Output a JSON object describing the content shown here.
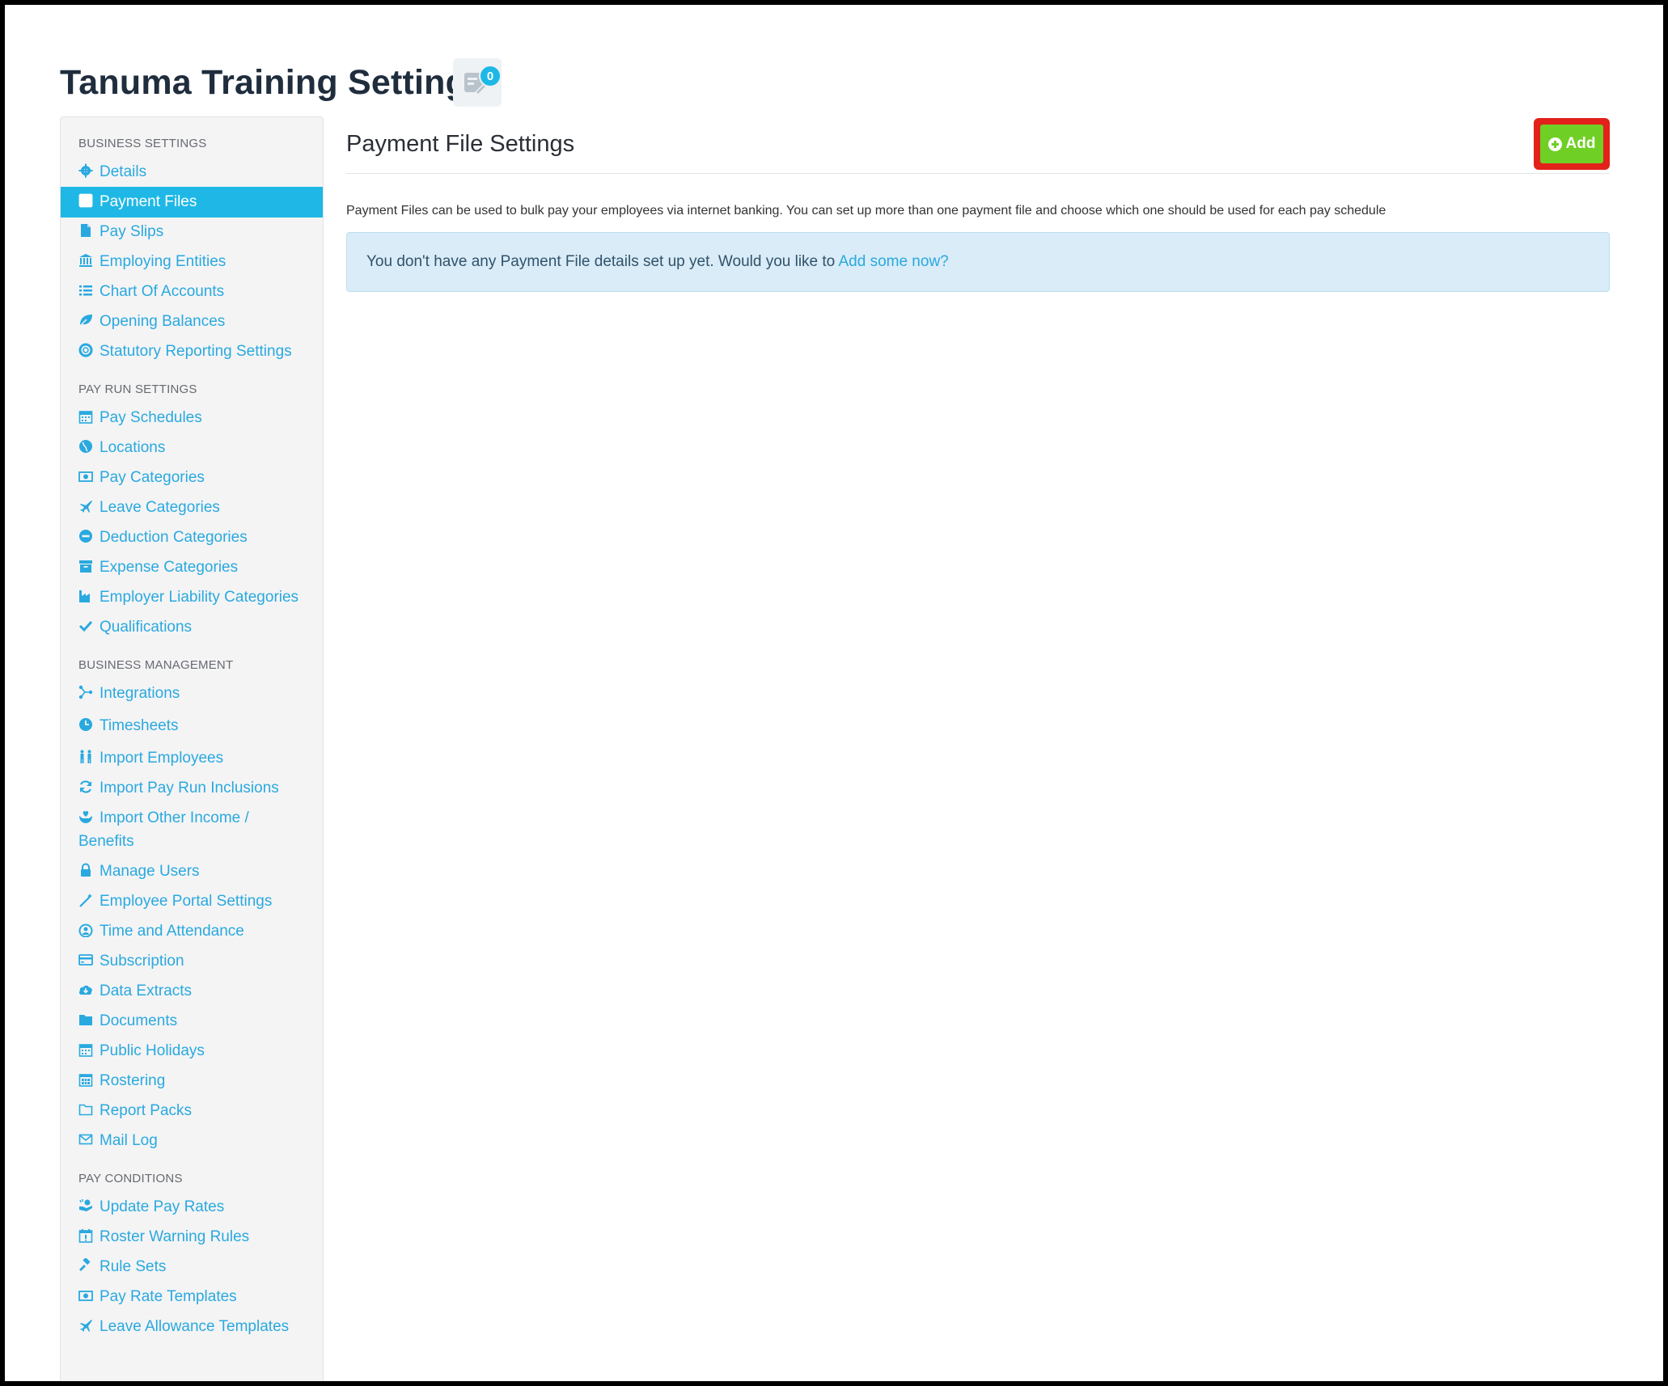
{
  "page": {
    "title": "Tanuma Training Settings",
    "notes_count": "0"
  },
  "sidebar": {
    "sections": [
      {
        "header": "BUSINESS SETTINGS"
      },
      {
        "header": "PAY RUN SETTINGS"
      },
      {
        "header": "BUSINESS MANAGEMENT"
      },
      {
        "header": "PAY CONDITIONS"
      }
    ],
    "items": [
      {
        "label": "Details",
        "icon": "gear-icon"
      },
      {
        "label": "Payment Files",
        "icon": "save-icon",
        "active": true
      },
      {
        "label": "Pay Slips",
        "icon": "file-icon"
      },
      {
        "label": "Employing Entities",
        "icon": "bank-icon"
      },
      {
        "label": "Chart Of Accounts",
        "icon": "list-icon"
      },
      {
        "label": "Opening Balances",
        "icon": "leaf-icon"
      },
      {
        "label": "Statutory Reporting Settings",
        "icon": "lifebuoy-icon"
      },
      {
        "label": "Pay Schedules",
        "icon": "calendar-icon"
      },
      {
        "label": "Locations",
        "icon": "globe-icon"
      },
      {
        "label": "Pay Categories",
        "icon": "money-icon"
      },
      {
        "label": "Leave Categories",
        "icon": "plane-icon"
      },
      {
        "label": "Deduction Categories",
        "icon": "minus-circle-icon"
      },
      {
        "label": "Expense Categories",
        "icon": "archive-icon"
      },
      {
        "label": "Employer Liability Categories",
        "icon": "industry-icon"
      },
      {
        "label": "Qualifications",
        "icon": "check-icon"
      },
      {
        "label": "Integrations",
        "icon": "share-nodes-icon"
      },
      {
        "label": "Timesheets",
        "icon": "clock-icon"
      },
      {
        "label": "Import Employees",
        "icon": "people-icon"
      },
      {
        "label": "Import Pay Run Inclusions",
        "icon": "refresh-icon"
      },
      {
        "label": "Import Other Income /",
        "label2": "Benefits",
        "icon": "hand-heart-icon"
      },
      {
        "label": "Manage Users",
        "icon": "lock-icon"
      },
      {
        "label": "Employee Portal Settings",
        "icon": "wand-icon"
      },
      {
        "label": "Time and Attendance",
        "icon": "user-clock-icon"
      },
      {
        "label": "Subscription",
        "icon": "credit-card-icon"
      },
      {
        "label": "Data Extracts",
        "icon": "cloud-download-icon"
      },
      {
        "label": "Documents",
        "icon": "folder-icon"
      },
      {
        "label": "Public Holidays",
        "icon": "calendar-icon"
      },
      {
        "label": "Rostering",
        "icon": "calendar-grid-icon"
      },
      {
        "label": "Report Packs",
        "icon": "folder-outline-icon"
      },
      {
        "label": "Mail Log",
        "icon": "envelope-icon"
      },
      {
        "label": "Update Pay Rates",
        "icon": "hand-money-icon"
      },
      {
        "label": "Roster Warning Rules",
        "icon": "calendar-alert-icon"
      },
      {
        "label": "Rule Sets",
        "icon": "gavel-icon"
      },
      {
        "label": "Pay Rate Templates",
        "icon": "money-icon"
      },
      {
        "label": "Leave Allowance Templates",
        "icon": "plane-icon"
      }
    ]
  },
  "main": {
    "title": "Payment File Settings",
    "add_label": "Add",
    "description": "Payment Files can be used to bulk pay your employees via internet banking. You can set up more than one payment file and choose which one should be used for each pay schedule",
    "info_text": "You don't have any Payment File details set up yet. Would you like to ",
    "info_link": "Add some now?"
  },
  "colors": {
    "accent": "#1fb8e6",
    "link": "#29a9df",
    "add_button": "#6fcf24",
    "highlight": "#e3211b",
    "info_bg": "#d9ecf7"
  }
}
